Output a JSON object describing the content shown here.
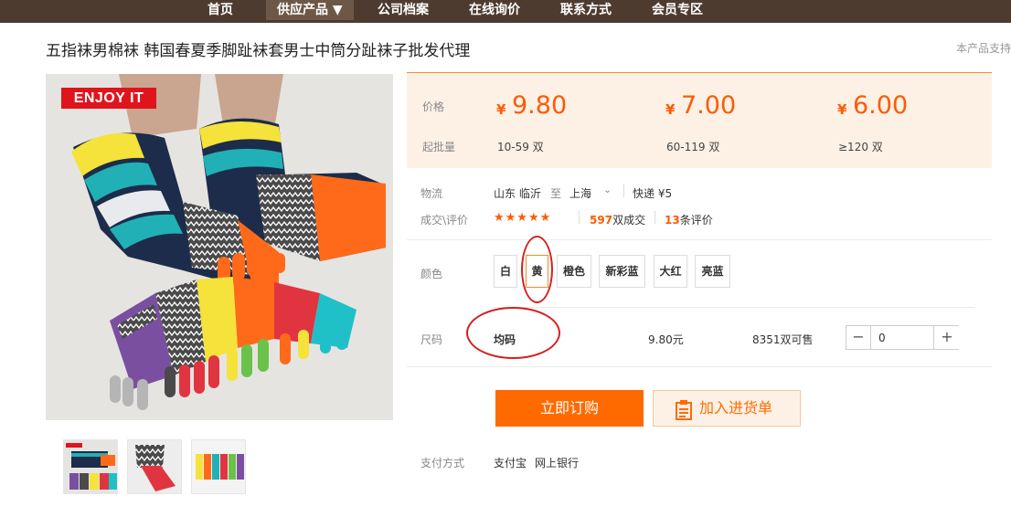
{
  "nav": {
    "items": [
      "首页",
      "供应产品 ▼",
      "公司档案",
      "在线询价",
      "联系方式",
      "会员专区"
    ]
  },
  "product": {
    "title": "五指袜男棉袜 韩国春夏季脚趾袜套男士中筒分趾袜子批发代理",
    "support_text": "本产品支持",
    "badge": "ENJOY IT"
  },
  "price": {
    "price_label": "价格",
    "moq_label": "起批量",
    "currency": "¥",
    "tiers": [
      {
        "price": "9.80",
        "qty": "10-59 双"
      },
      {
        "price": "7.00",
        "qty": "60-119 双"
      },
      {
        "price": "6.00",
        "qty": "≥120 双"
      }
    ]
  },
  "logistics": {
    "label": "物流",
    "from": "山东 临沂",
    "to_word": "至",
    "to": "上海",
    "shipping": "快递 ¥5"
  },
  "deals": {
    "label": "成交\\评价",
    "stars": "★★★★★",
    "deal_count": "597",
    "deal_suffix": "双成交",
    "review_count": "13",
    "review_suffix": "条评价"
  },
  "color": {
    "label": "颜色",
    "options": [
      "白",
      "黄",
      "橙色",
      "新彩蓝",
      "大红",
      "亮蓝"
    ],
    "selected": "黄"
  },
  "size": {
    "label": "尺码",
    "value": "均码",
    "price": "9.80元",
    "stock": "8351双可售",
    "quantity": "0",
    "minus": "−",
    "plus": "+"
  },
  "actions": {
    "buy_label": "立即订购",
    "cart_label": "加入进货单"
  },
  "payment": {
    "label": "支付方式",
    "methods": [
      "支付宝",
      "网上银行"
    ]
  },
  "colors": {
    "nav_bg": "#4e3b2f",
    "accent": "#ff6a00",
    "annotation_red": "#d42020"
  }
}
